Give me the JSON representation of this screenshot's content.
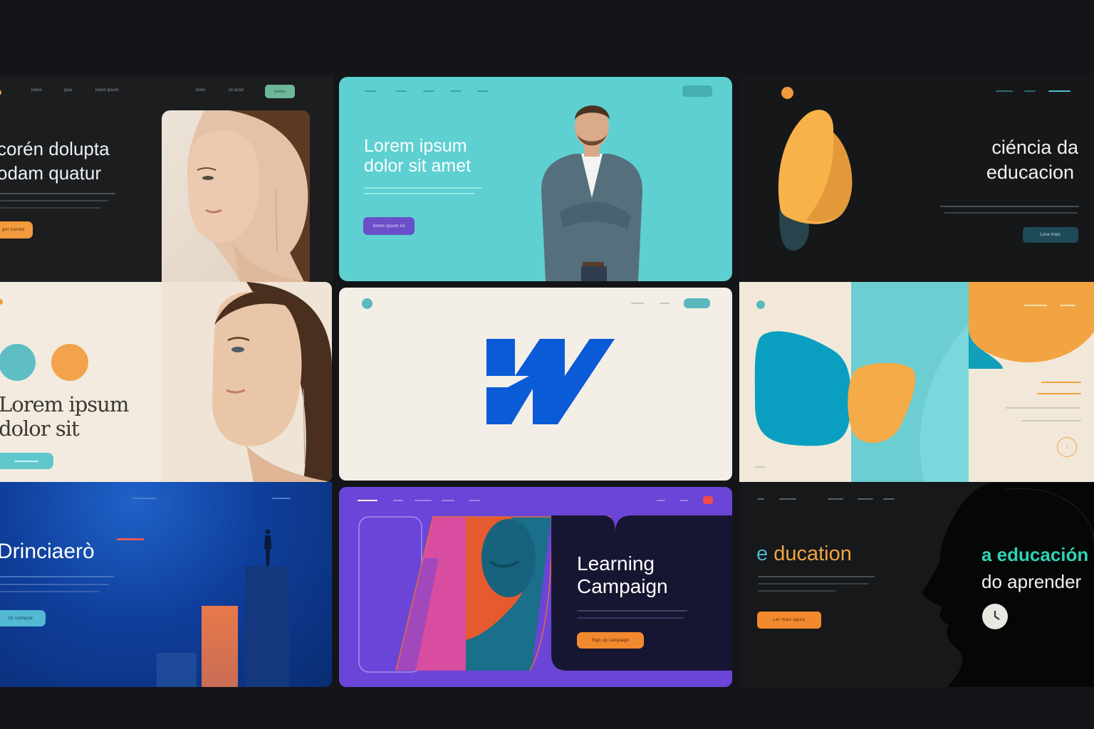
{
  "colors": {
    "page_bg": "#141518",
    "teal": "#5fd0d0",
    "orange": "#f39a3d",
    "purple": "#6a45d8",
    "webflow_blue": "#0b5bd6",
    "navy": "#171632",
    "cream": "#f3efe7"
  },
  "card1": {
    "nav": [
      "lorem",
      "ipsa",
      "lorem ipsum",
      "dolor",
      "sit amet"
    ],
    "nav_button": "button",
    "headline_line1": "corén dolupta",
    "headline_line2": "odam quatur",
    "cta": "get started"
  },
  "card2": {
    "headline_line1": "Lorem ipsum",
    "headline_line2": "dolor sit amet",
    "cta": "lorem ipsum sit"
  },
  "card3": {
    "headline_line1": "ciéncia da",
    "headline_line2": "educacion",
    "cta": "Leia mais"
  },
  "card4": {
    "headline_line1": "Lorem ipsum",
    "headline_line2": "dolor sit"
  },
  "card5": {
    "logo_icon": "webflow-logo"
  },
  "card6": {
    "icon": "arrow-circle-icon"
  },
  "card7": {
    "headline": "Drinciaerò",
    "cta": "Or contacte"
  },
  "card8": {
    "headline_line1": "Learning",
    "headline_line2": "Campaign",
    "cta": "Sign up campaign"
  },
  "card9": {
    "headline_left": "e ducation",
    "headline_right_line1": "a educación",
    "headline_right_line2": "do aprender",
    "cta": "Ler mais agora",
    "icon": "clock-icon"
  }
}
